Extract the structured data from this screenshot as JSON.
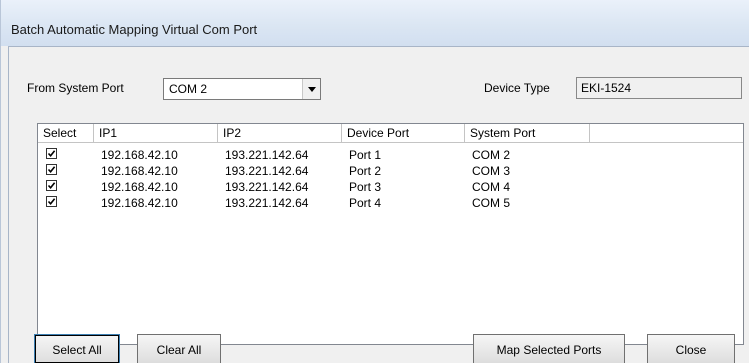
{
  "window": {
    "title": "Batch Automatic Mapping Virtual Com Port"
  },
  "form": {
    "from_label": "From System Port",
    "from_value": "COM 2",
    "device_type_label": "Device Type",
    "device_type_value": "EKI-1524"
  },
  "table": {
    "headers": [
      "Select",
      "IP1",
      "IP2",
      "Device Port",
      "System Port"
    ],
    "rows": [
      {
        "checked": true,
        "ip1": "192.168.42.10",
        "ip2": "193.221.142.64",
        "device_port": "Port 1",
        "system_port": "COM 2"
      },
      {
        "checked": true,
        "ip1": "192.168.42.10",
        "ip2": "193.221.142.64",
        "device_port": "Port 2",
        "system_port": "COM 3"
      },
      {
        "checked": true,
        "ip1": "192.168.42.10",
        "ip2": "193.221.142.64",
        "device_port": "Port 3",
        "system_port": "COM 4"
      },
      {
        "checked": true,
        "ip1": "192.168.42.10",
        "ip2": "193.221.142.64",
        "device_port": "Port 4",
        "system_port": "COM 5"
      }
    ]
  },
  "buttons": {
    "select_all": "Select All",
    "clear_all": "Clear All",
    "map_selected": "Map Selected Ports",
    "close": "Close"
  }
}
